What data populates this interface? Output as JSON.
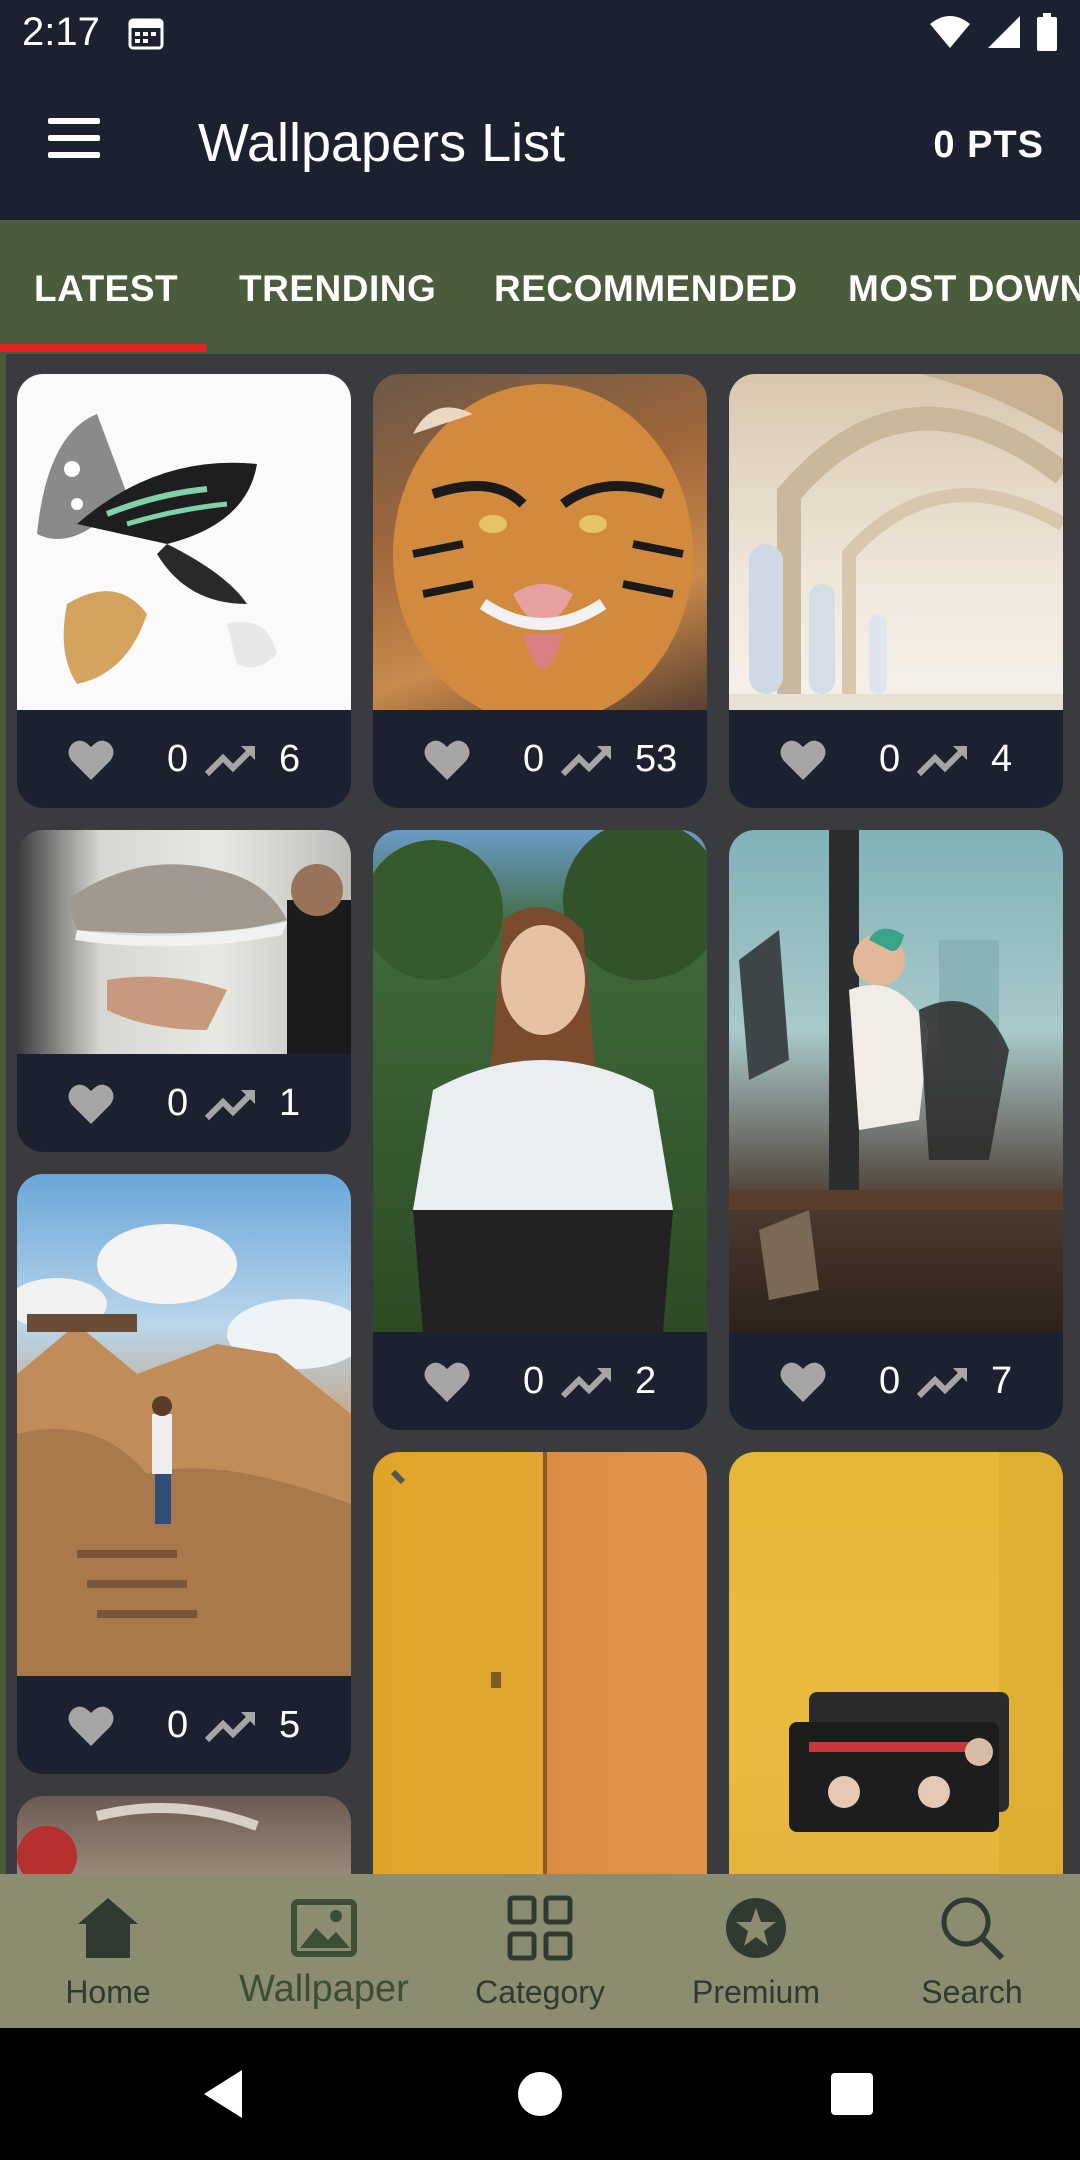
{
  "status_bar": {
    "time": "2:17"
  },
  "header": {
    "title": "Wallpapers List",
    "points": "0 PTS"
  },
  "tabs": [
    {
      "label": "LATEST",
      "selected": true
    },
    {
      "label": "TRENDING",
      "selected": false
    },
    {
      "label": "RECOMMENDED",
      "selected": false
    },
    {
      "label": "MOST DOWN",
      "selected": false
    }
  ],
  "wallpapers": [
    {
      "subject": "butterflies",
      "likes": "0",
      "views": "6"
    },
    {
      "subject": "tiger",
      "likes": "0",
      "views": "53"
    },
    {
      "subject": "arched hall",
      "likes": "0",
      "views": "4"
    },
    {
      "subject": "sneaker",
      "likes": "0",
      "views": "1"
    },
    {
      "subject": "woman portrait",
      "likes": "0",
      "views": "2"
    },
    {
      "subject": "woman at desk",
      "likes": "0",
      "views": "7"
    },
    {
      "subject": "rock canyon",
      "likes": "0",
      "views": "5"
    },
    {
      "subject": "yellow door"
    },
    {
      "subject": "cassette tapes"
    },
    {
      "subject": "partial image"
    }
  ],
  "bottom_nav": [
    {
      "label": "Home",
      "icon": "home-icon",
      "active": false
    },
    {
      "label": "Wallpaper",
      "icon": "image-icon",
      "active": true
    },
    {
      "label": "Category",
      "icon": "grid-icon",
      "active": false
    },
    {
      "label": "Premium",
      "icon": "star-badge-icon",
      "active": false
    },
    {
      "label": "Search",
      "icon": "search-icon",
      "active": false
    }
  ],
  "colors": {
    "app_bar": "#1c2130",
    "tab_bar": "#4a5c3c",
    "tab_indicator": "#e3231e",
    "bottom_nav": "#8c8c70",
    "card_meta": "#1c2130"
  }
}
